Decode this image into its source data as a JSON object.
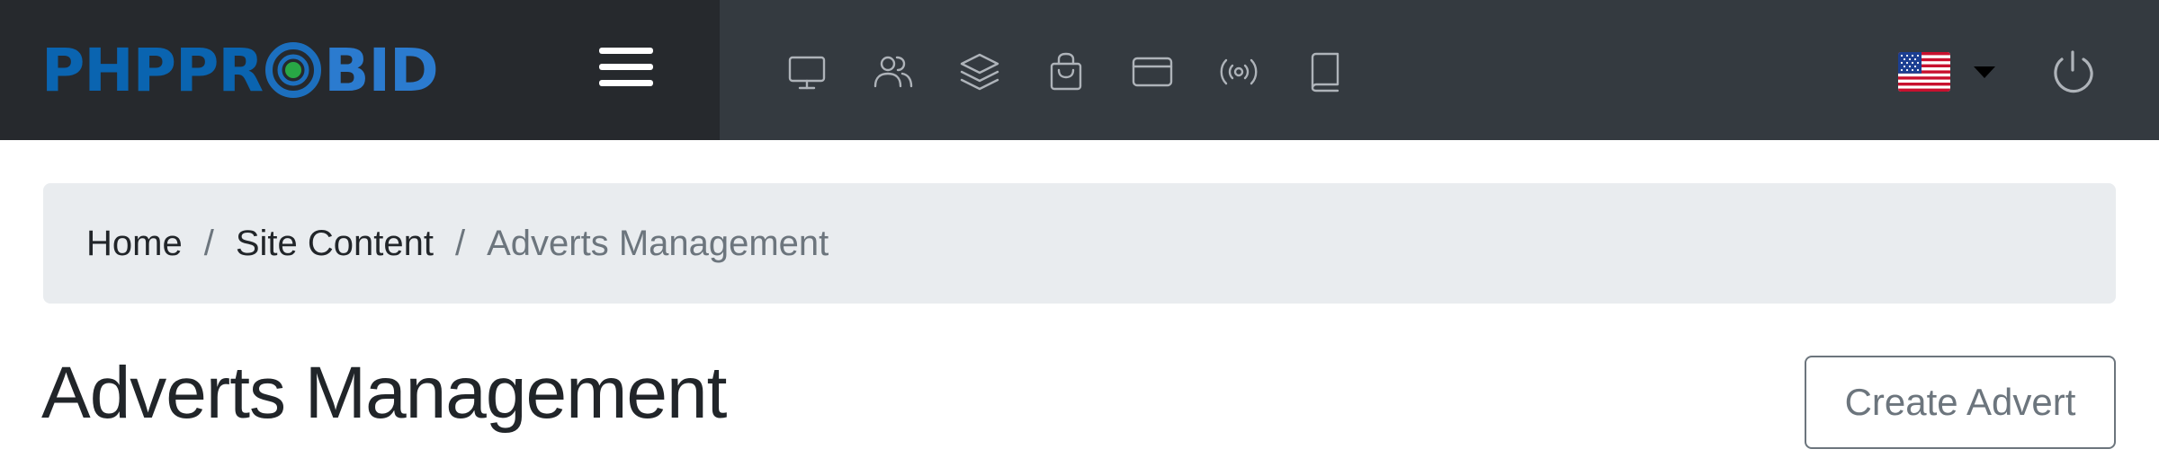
{
  "brand": {
    "logo_part1": "PHPPR",
    "logo_part2": "BID",
    "colors": {
      "primary": "#0a64b0",
      "secondary": "#2b7bcf",
      "ring_accent": "#28a745"
    }
  },
  "navbar": {
    "background": "#343a40",
    "brand_background": "#26292d",
    "menu_icon": "hamburger-menu-icon",
    "icons": [
      "desktop-icon",
      "users-icon",
      "layers-icon",
      "shopping-bag-icon",
      "credit-card-icon",
      "broadcast-icon",
      "book-icon"
    ],
    "language_flag": "us-flag-icon",
    "dropdown_icon": "caret-down-icon",
    "logout_icon": "power-icon"
  },
  "breadcrumb": {
    "items": [
      "Home",
      "Site Content"
    ],
    "active": "Adverts Management",
    "separator": "/"
  },
  "page": {
    "title": "Adverts Management",
    "create_button": "Create Advert"
  }
}
